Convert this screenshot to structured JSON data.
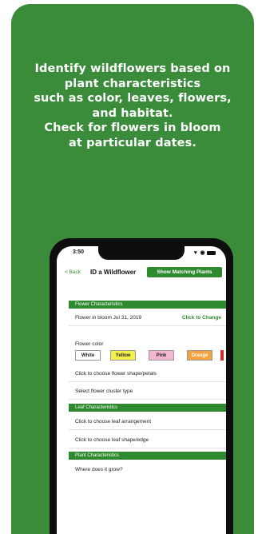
{
  "headline": [
    "Identify wildflowers based on",
    "plant characteristics",
    "such as color, leaves, flowers,",
    "and habitat.",
    "Check for flowers in bloom",
    "at particular dates."
  ],
  "status": {
    "time": "3:50",
    "indicators": "▾ ◉"
  },
  "nav": {
    "back_label": "< Back",
    "title": "ID a Wildflower",
    "show_button": "Show Matching Plants"
  },
  "sections": {
    "flower": "Flower Characteristics",
    "leaf": "Leaf Characteristics",
    "plant": "Plant Characteristics"
  },
  "rows": {
    "bloom": "Flower in bloom Jul 31, 2019",
    "bloom_action": "Click to Change",
    "flower_color_label": "Flower color",
    "shape": "Click to choose flower shape/petals",
    "cluster": "Select flower cluster type",
    "leaf_arrangement": "Click to choose leaf arrangement",
    "leaf_shape": "Click to choose leaf shape/edge",
    "grow": "Where does it grow?"
  },
  "colors": {
    "card_bg": "#3a8b3a",
    "accent": "#2f8a2f",
    "swatches": [
      {
        "label": "White",
        "color": "#ffffff"
      },
      {
        "label": "Yellow",
        "color": "#f4f04a"
      },
      {
        "label": "Pink",
        "color": "#f4b6d0"
      },
      {
        "label": "Orange",
        "color": "#f3a23f"
      },
      {
        "label": "",
        "color": "#d02b2b"
      }
    ]
  }
}
